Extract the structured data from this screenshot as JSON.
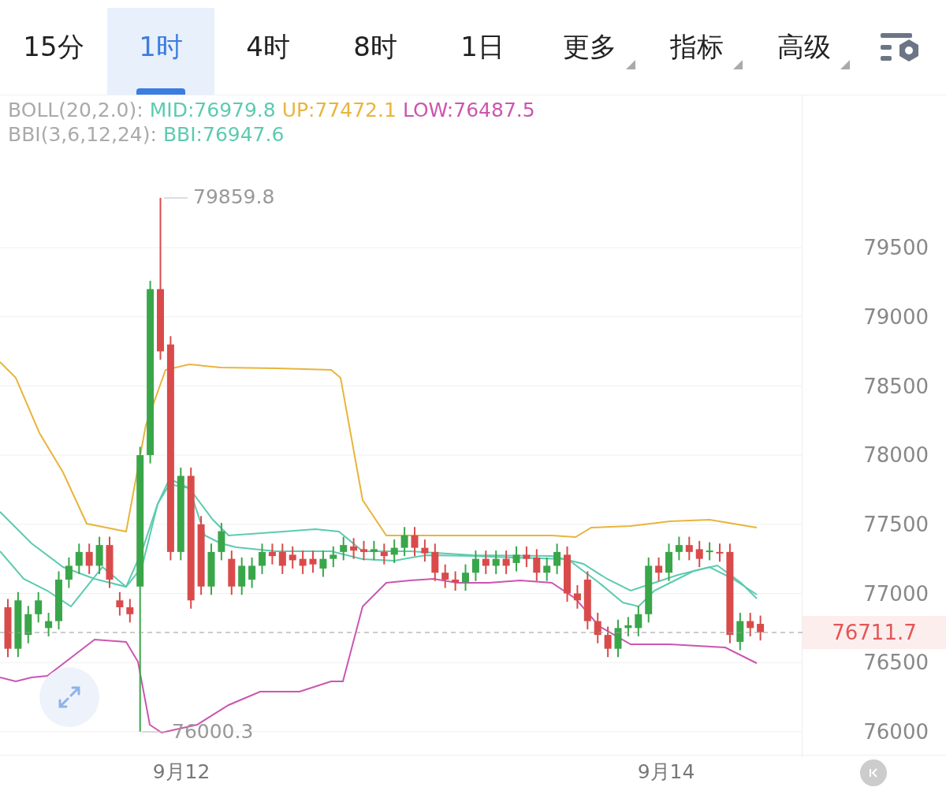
{
  "tabs": [
    {
      "label": "15分",
      "selected": false,
      "menu": false
    },
    {
      "label": "1时",
      "selected": true,
      "menu": false
    },
    {
      "label": "4时",
      "selected": false,
      "menu": false
    },
    {
      "label": "8时",
      "selected": false,
      "menu": false
    },
    {
      "label": "1日",
      "selected": false,
      "menu": false
    },
    {
      "label": "更多",
      "selected": false,
      "menu": true
    },
    {
      "label": "指标",
      "selected": false,
      "menu": true
    },
    {
      "label": "高级",
      "selected": false,
      "menu": true
    }
  ],
  "legend": [
    {
      "label": "BOLL(20,2.0):",
      "items": [
        {
          "text": "MID:76979.8",
          "color": "#5ccbb0"
        },
        {
          "text": "UP:77472.1",
          "color": "#e9b43c"
        },
        {
          "text": "LOW:76487.5",
          "color": "#cc55b0"
        }
      ]
    },
    {
      "label": "BBI(3,6,12,24):",
      "items": [
        {
          "text": "BBI:76947.6",
          "color": "#5ccbb0"
        }
      ]
    }
  ],
  "chart": {
    "max_label": "79859.8",
    "min_label": "76000.3",
    "yticks": [
      "79500",
      "79000",
      "78500",
      "78000",
      "77500",
      "77000",
      "76500",
      "76000"
    ],
    "last_price": "76711.7",
    "dates": [
      "9月12",
      "9月14"
    ]
  }
}
